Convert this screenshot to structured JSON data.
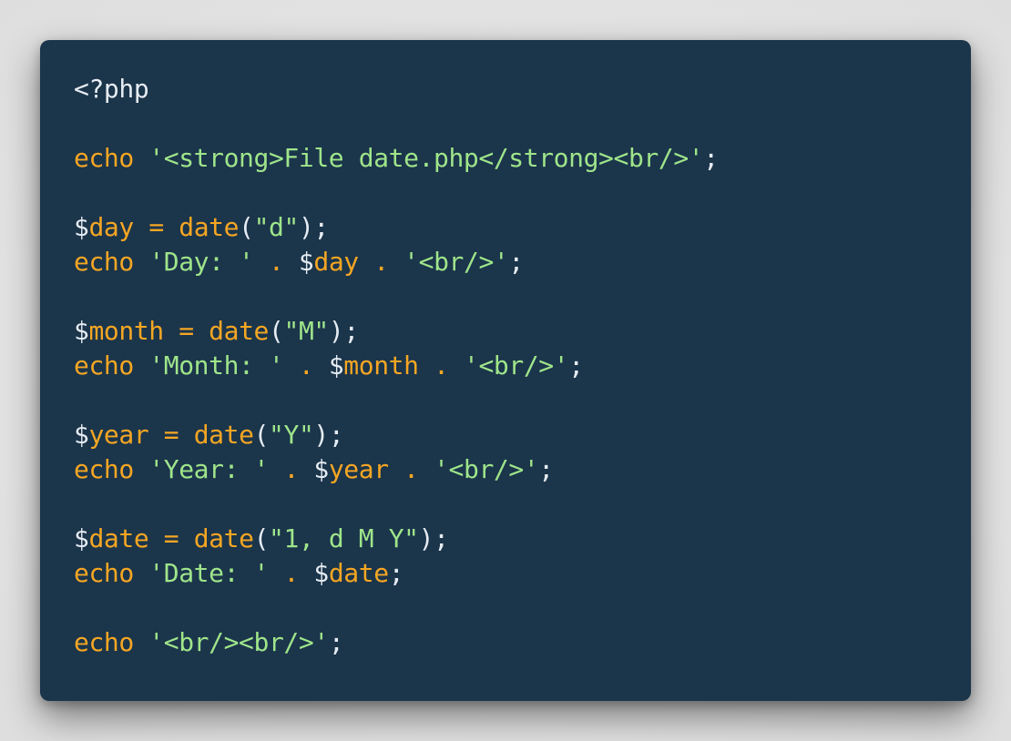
{
  "colors": {
    "background": "#1b354b",
    "keyword": "#f5a623",
    "string": "#9fe58a",
    "text": "#e6ecf2"
  },
  "code": {
    "language": "php",
    "lines": [
      [
        {
          "t": "plain",
          "s": "<?php"
        }
      ],
      [],
      [
        {
          "t": "kw",
          "s": "echo"
        },
        {
          "t": "plain",
          "s": " "
        },
        {
          "t": "str",
          "s": "'<strong>File date.php</strong><br/>'"
        },
        {
          "t": "plain",
          "s": ";"
        }
      ],
      [],
      [
        {
          "t": "plain",
          "s": "$"
        },
        {
          "t": "var",
          "s": "day"
        },
        {
          "t": "plain",
          "s": " "
        },
        {
          "t": "op",
          "s": "="
        },
        {
          "t": "plain",
          "s": " "
        },
        {
          "t": "kw",
          "s": "date"
        },
        {
          "t": "plain",
          "s": "("
        },
        {
          "t": "str",
          "s": "\"d\""
        },
        {
          "t": "plain",
          "s": ");"
        }
      ],
      [
        {
          "t": "kw",
          "s": "echo"
        },
        {
          "t": "plain",
          "s": " "
        },
        {
          "t": "str",
          "s": "'Day: '"
        },
        {
          "t": "plain",
          "s": " "
        },
        {
          "t": "op",
          "s": "."
        },
        {
          "t": "plain",
          "s": " $"
        },
        {
          "t": "var",
          "s": "day"
        },
        {
          "t": "plain",
          "s": " "
        },
        {
          "t": "op",
          "s": "."
        },
        {
          "t": "plain",
          "s": " "
        },
        {
          "t": "str",
          "s": "'<br/>'"
        },
        {
          "t": "plain",
          "s": ";"
        }
      ],
      [],
      [
        {
          "t": "plain",
          "s": "$"
        },
        {
          "t": "var",
          "s": "month"
        },
        {
          "t": "plain",
          "s": " "
        },
        {
          "t": "op",
          "s": "="
        },
        {
          "t": "plain",
          "s": " "
        },
        {
          "t": "kw",
          "s": "date"
        },
        {
          "t": "plain",
          "s": "("
        },
        {
          "t": "str",
          "s": "\"M\""
        },
        {
          "t": "plain",
          "s": ");"
        }
      ],
      [
        {
          "t": "kw",
          "s": "echo"
        },
        {
          "t": "plain",
          "s": " "
        },
        {
          "t": "str",
          "s": "'Month: '"
        },
        {
          "t": "plain",
          "s": " "
        },
        {
          "t": "op",
          "s": "."
        },
        {
          "t": "plain",
          "s": " $"
        },
        {
          "t": "var",
          "s": "month"
        },
        {
          "t": "plain",
          "s": " "
        },
        {
          "t": "op",
          "s": "."
        },
        {
          "t": "plain",
          "s": " "
        },
        {
          "t": "str",
          "s": "'<br/>'"
        },
        {
          "t": "plain",
          "s": ";"
        }
      ],
      [],
      [
        {
          "t": "plain",
          "s": "$"
        },
        {
          "t": "var",
          "s": "year"
        },
        {
          "t": "plain",
          "s": " "
        },
        {
          "t": "op",
          "s": "="
        },
        {
          "t": "plain",
          "s": " "
        },
        {
          "t": "kw",
          "s": "date"
        },
        {
          "t": "plain",
          "s": "("
        },
        {
          "t": "str",
          "s": "\"Y\""
        },
        {
          "t": "plain",
          "s": ");"
        }
      ],
      [
        {
          "t": "kw",
          "s": "echo"
        },
        {
          "t": "plain",
          "s": " "
        },
        {
          "t": "str",
          "s": "'Year: '"
        },
        {
          "t": "plain",
          "s": " "
        },
        {
          "t": "op",
          "s": "."
        },
        {
          "t": "plain",
          "s": " $"
        },
        {
          "t": "var",
          "s": "year"
        },
        {
          "t": "plain",
          "s": " "
        },
        {
          "t": "op",
          "s": "."
        },
        {
          "t": "plain",
          "s": " "
        },
        {
          "t": "str",
          "s": "'<br/>'"
        },
        {
          "t": "plain",
          "s": ";"
        }
      ],
      [],
      [
        {
          "t": "plain",
          "s": "$"
        },
        {
          "t": "var",
          "s": "date"
        },
        {
          "t": "plain",
          "s": " "
        },
        {
          "t": "op",
          "s": "="
        },
        {
          "t": "plain",
          "s": " "
        },
        {
          "t": "kw",
          "s": "date"
        },
        {
          "t": "plain",
          "s": "("
        },
        {
          "t": "str",
          "s": "\"1, d M Y\""
        },
        {
          "t": "plain",
          "s": ");"
        }
      ],
      [
        {
          "t": "kw",
          "s": "echo"
        },
        {
          "t": "plain",
          "s": " "
        },
        {
          "t": "str",
          "s": "'Date: '"
        },
        {
          "t": "plain",
          "s": " "
        },
        {
          "t": "op",
          "s": "."
        },
        {
          "t": "plain",
          "s": " $"
        },
        {
          "t": "var",
          "s": "date"
        },
        {
          "t": "plain",
          "s": ";"
        }
      ],
      [],
      [
        {
          "t": "kw",
          "s": "echo"
        },
        {
          "t": "plain",
          "s": " "
        },
        {
          "t": "str",
          "s": "'<br/><br/>'"
        },
        {
          "t": "plain",
          "s": ";"
        }
      ]
    ]
  }
}
